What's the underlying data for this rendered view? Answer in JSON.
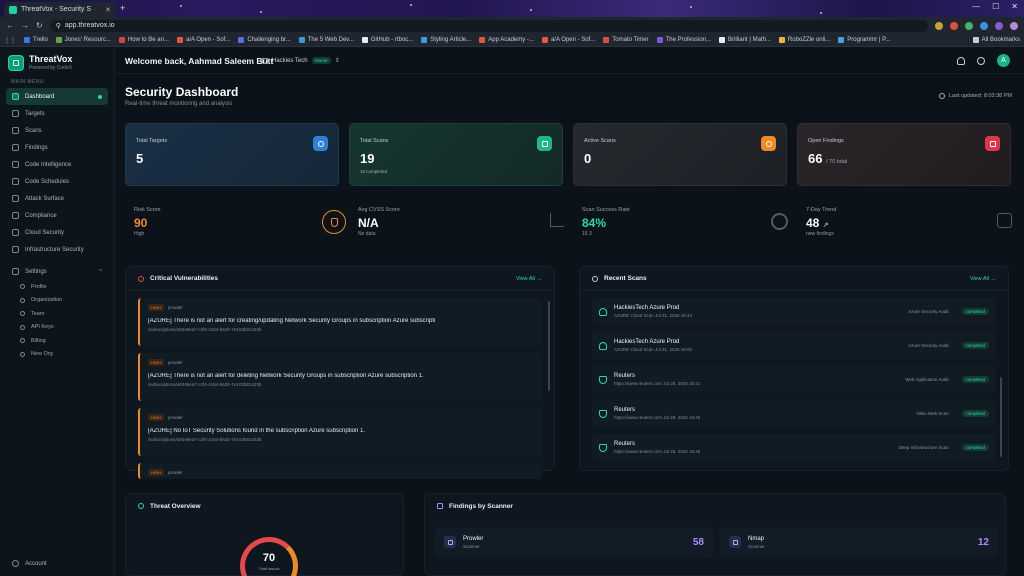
{
  "browser": {
    "tab_title": "ThreatVox - Security S",
    "url": "app.threatvox.io",
    "bookmarks": [
      "Trello",
      "Jones' Resourc...",
      "How to Be an...",
      "a/A Open - Sof...",
      "Challenging br...",
      "The 5 Web Dev...",
      "GitHub - rtboc...",
      "Styling Article...",
      "App Academy -...",
      "a/A Open - Sof...",
      "Tomato Timer",
      "The Profession...",
      "Brilliant | Math...",
      "RoboZZle onli...",
      "Programmr | P..."
    ],
    "all_bookmarks": "All Bookmarks"
  },
  "brand": {
    "name": "ThreatVox",
    "tagline": "Powered by CodeX"
  },
  "sidebar": {
    "main_menu": "MAIN MENU",
    "items": [
      {
        "label": "Dashboard"
      },
      {
        "label": "Targets"
      },
      {
        "label": "Scans"
      },
      {
        "label": "Findings"
      },
      {
        "label": "Code Intelligence"
      },
      {
        "label": "Code Schedules"
      },
      {
        "label": "Attack Surface"
      },
      {
        "label": "Compliance"
      },
      {
        "label": "Cloud Security"
      },
      {
        "label": "Infrastructure Security"
      }
    ],
    "settings": "Settings",
    "sub_items": [
      {
        "label": "Profile"
      },
      {
        "label": "Organization"
      },
      {
        "label": "Team"
      },
      {
        "label": "API Keys"
      },
      {
        "label": "Billing"
      },
      {
        "label": "New Org"
      }
    ],
    "account": "Account"
  },
  "header": {
    "welcome": "Welcome back, Aahmad Saleem Butt",
    "org_name": "Hackies Tech",
    "org_badge": "Owner",
    "avatar_letter": "A"
  },
  "page": {
    "title": "Security Dashboard",
    "subtitle": "Real-time threat monitoring and analysis",
    "last_updated": "Last updated: 8:03:38 PM"
  },
  "stats": [
    {
      "label": "Total Targets",
      "value": "5",
      "suffix": "",
      "sub": ""
    },
    {
      "label": "Total Scans",
      "value": "19",
      "suffix": "",
      "sub": "15 completed"
    },
    {
      "label": "Active Scans",
      "value": "0",
      "suffix": "",
      "sub": ""
    },
    {
      "label": "Open Findings",
      "value": "66",
      "suffix": "/ 70 total",
      "sub": ""
    }
  ],
  "metrics": [
    {
      "label": "Risk Score",
      "value": "90",
      "sub": "High"
    },
    {
      "label": "Avg CVSS Score",
      "value": "N/A",
      "sub": "No data"
    },
    {
      "label": "Scan Success Rate",
      "value": "84%",
      "sub": "16   3"
    },
    {
      "label": "7-Day Trend",
      "value": "48",
      "sub": "new findings"
    }
  ],
  "critical": {
    "title": "Critical Vulnerabilities",
    "view_all": "View All →",
    "items": [
      {
        "severity": "HIGH",
        "source": "prowler",
        "title": "[AZURE] There is not an alert for creating/updating Network Security Groups in subscription Azure subscripti",
        "path": "/subscriptions/a9349ea7-c2f4-4164-b62b-7e103b81433b"
      },
      {
        "severity": "HIGH",
        "source": "prowler",
        "title": "[AZURE] There is not an alert for deleting Network Security Groups in subscription Azure subscription 1.",
        "path": "/subscriptions/a9349ea7-c2f4-4164-b62b-7e103b81433b"
      },
      {
        "severity": "HIGH",
        "source": "prowler",
        "title": "[AZURE] No IoT Security Solutions found in the subscription Azure subscription 1.",
        "path": "/subscriptions/a9349ea7-c2f4-4164-b62b-7e103b81433b"
      },
      {
        "severity": "HIGH",
        "source": "prowler",
        "title": "",
        "path": ""
      }
    ]
  },
  "recent": {
    "title": "Recent Scans",
    "view_all": "View All →",
    "items": [
      {
        "name": "HackiesTech Azure Prod",
        "detail": "AZURE Cloud Scan  Jul 31, 2026 19:44",
        "type": "Azure Security Audit",
        "status": "completed"
      },
      {
        "name": "HackiesTech Azure Prod",
        "detail": "AZURE Cloud Scan  Jul 31, 2026 16:00",
        "type": "Azure Security Audit",
        "status": "completed"
      },
      {
        "name": "Reuters",
        "detail": "https://www.reuters.com  Jul 28, 2026 18:41",
        "type": "Web Application Audit",
        "status": "completed"
      },
      {
        "name": "Reuters",
        "detail": "https://www.reuters.com  Jul 28, 2026 18:40",
        "type": "Nikto Web Scan",
        "status": "completed"
      },
      {
        "name": "Reuters",
        "detail": "https://www.reuters.com  Jul 28, 2026 18:40",
        "type": "Deep Infrastructure Scan",
        "status": "completed"
      }
    ]
  },
  "threat": {
    "title": "Threat Overview",
    "value": "70",
    "label": "Total Issues"
  },
  "scanners": {
    "title": "Findings by Scanner",
    "items": [
      {
        "name": "Prowler",
        "sub": "Scanner",
        "value": "58"
      },
      {
        "name": "Nmap",
        "sub": "Scanner",
        "value": "12"
      }
    ]
  },
  "colors": {
    "accent": "#2bd8a9",
    "high": "#f08a24",
    "critical": "#e5484d",
    "scanner_value": "#a78bfa"
  }
}
